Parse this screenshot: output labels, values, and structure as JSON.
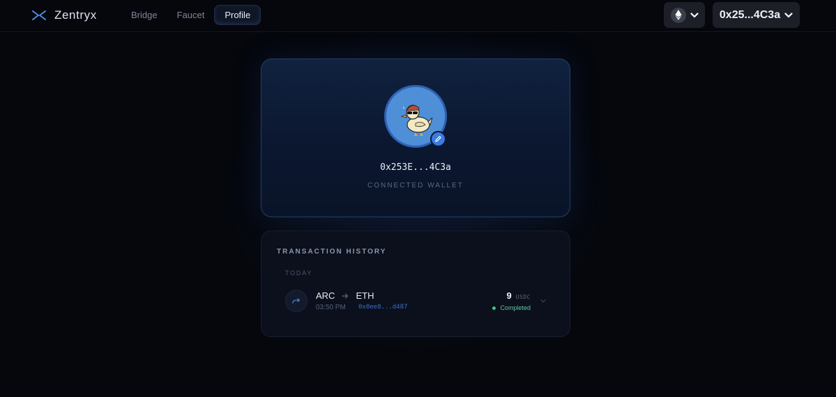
{
  "app": {
    "brand_name": "Zentryx",
    "brand_icon": "x-arrows-logo-icon"
  },
  "nav": {
    "tabs": [
      {
        "label": "Bridge",
        "active": false
      },
      {
        "label": "Faucet",
        "active": false
      },
      {
        "label": "Profile",
        "active": true
      }
    ]
  },
  "header": {
    "chain_icon": "ethereum-icon",
    "wallet_label": "0x25...4C3a"
  },
  "profile": {
    "avatar": "duck-with-sunglasses-avatar",
    "edit_icon": "pencil-icon",
    "address": "0x253E...4C3a",
    "caption": "CONNECTED WALLET"
  },
  "transactions": {
    "title": "TRANSACTION HISTORY",
    "groups": [
      {
        "label": "TODAY",
        "items": [
          {
            "from": "ARC",
            "to": "ETH",
            "time": "03:50 PM",
            "hash": "0x0ee8...d487",
            "amount": "9",
            "unit": "USDC",
            "status": "Completed"
          }
        ]
      }
    ]
  },
  "colors": {
    "background": "#05070d",
    "accent": "#3a7be0",
    "success": "#3fc385"
  }
}
